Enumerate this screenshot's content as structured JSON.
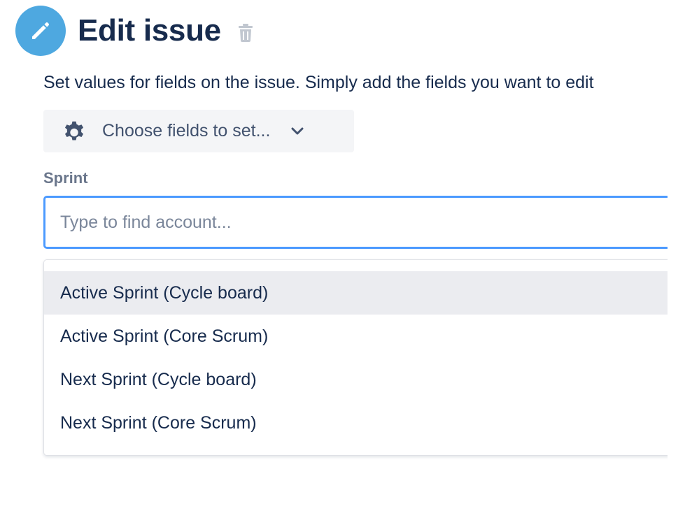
{
  "header": {
    "title": "Edit issue",
    "accent_color": "#4ea8e0"
  },
  "description": "Set values for fields on the issue. Simply add the fields you want to edit",
  "choose_fields": {
    "label": "Choose fields to set..."
  },
  "sprint_field": {
    "label": "Sprint",
    "placeholder": "Type to find account...",
    "value": "",
    "focus_color": "#4c9aff"
  },
  "dropdown": {
    "options": [
      {
        "label": "Active Sprint (Cycle board)",
        "highlighted": true
      },
      {
        "label": "Active Sprint (Core Scrum)",
        "highlighted": false
      },
      {
        "label": "Next Sprint (Cycle board)",
        "highlighted": false
      },
      {
        "label": "Next Sprint (Core Scrum)",
        "highlighted": false
      }
    ]
  },
  "icons": {
    "header": "pencil-icon",
    "delete": "trash-icon",
    "settings": "gear-icon",
    "expand": "chevron-down-icon"
  }
}
